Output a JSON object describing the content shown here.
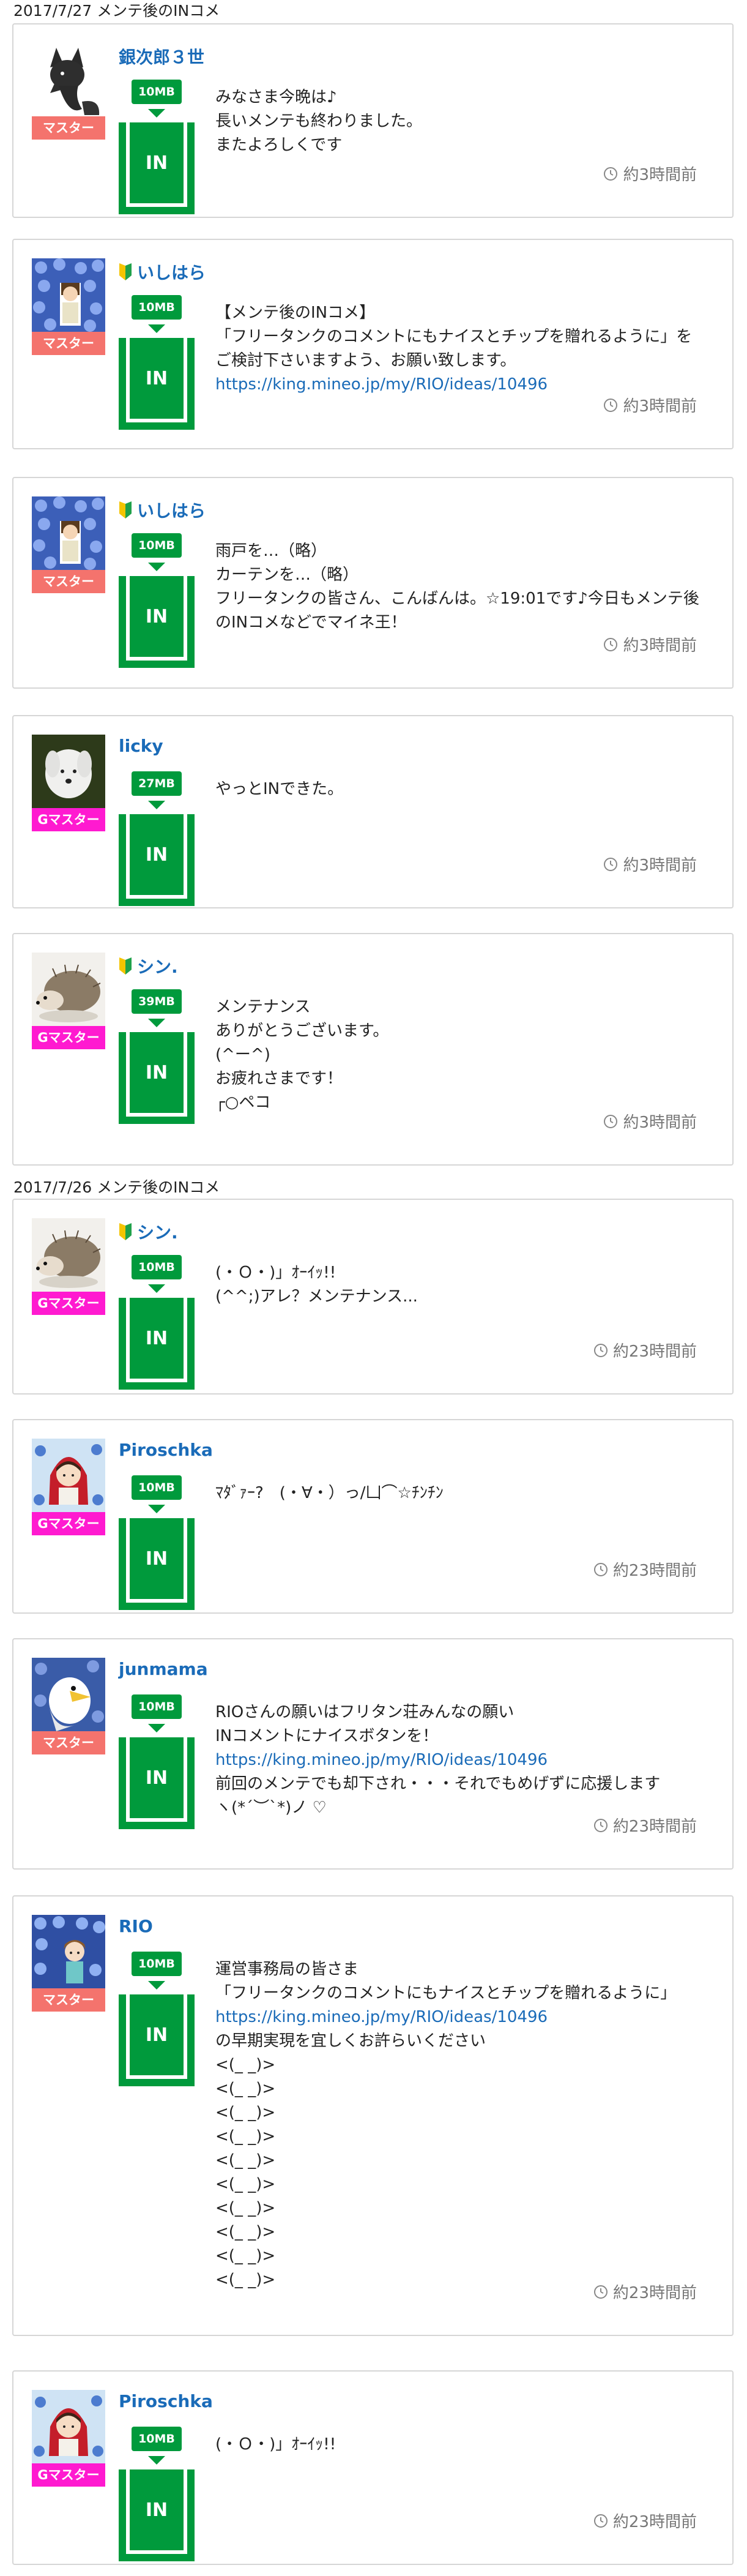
{
  "groups": [
    {
      "date_label": "2017/7/27 メンテ後のINコメ",
      "comments": [
        {
          "user": "銀次郎３世",
          "beginner": false,
          "rank": "マスター",
          "rank_type": "master",
          "avatar": "fox-avatar",
          "mb": "10MB",
          "in_label": "IN",
          "lines": [
            {
              "text": "みなさま今晩は♪"
            },
            {
              "text": "長いメンテも終わりました。"
            },
            {
              "text": "またよろしくです"
            }
          ],
          "time": "約3時間前"
        },
        {
          "user": "いしはら",
          "beginner": true,
          "rank": "マスター",
          "rank_type": "master",
          "avatar": "hydrangea-avatar",
          "mb": "10MB",
          "in_label": "IN",
          "lines": [
            {
              "text": "【メンテ後のINコメ】"
            },
            {
              "text": "「フリータンクのコメントにもナイスとチップを贈れるように」をご検討下さいますよう、お願い致します。"
            },
            {
              "text": "https://king.mineo.jp/my/RIO/ideas/10496",
              "link": true
            }
          ],
          "time": "約3時間前"
        },
        {
          "user": "いしはら",
          "beginner": true,
          "rank": "マスター",
          "rank_type": "master",
          "avatar": "hydrangea-avatar",
          "mb": "10MB",
          "in_label": "IN",
          "lines": [
            {
              "text": "雨戸を…（略）"
            },
            {
              "text": "カーテンを…（略）"
            },
            {
              "text": "フリータンクの皆さん、こんばんは。☆19:01です♪今日もメンテ後のINコメなどでマイネ王！"
            }
          ],
          "time": "約3時間前"
        },
        {
          "user": "licky",
          "beginner": false,
          "rank": "Gマスター",
          "rank_type": "g",
          "avatar": "dog-avatar",
          "mb": "27MB",
          "in_label": "IN",
          "lines": [
            {
              "text": "やっとINできた。"
            }
          ],
          "time": "約3時間前"
        },
        {
          "user": "シン.",
          "beginner": true,
          "rank": "Gマスター",
          "rank_type": "g",
          "avatar": "hedgehog-avatar",
          "mb": "39MB",
          "in_label": "IN",
          "lines": [
            {
              "text": "メンテナンス"
            },
            {
              "text": "ありがとうございます。"
            },
            {
              "text": "(^ー^)"
            },
            {
              "text": "お疲れさまです！"
            },
            {
              "text": "┌○ペコ"
            }
          ],
          "time": "約3時間前"
        }
      ]
    },
    {
      "date_label": "2017/7/26 メンテ後のINコメ",
      "comments": [
        {
          "user": "シン.",
          "beginner": true,
          "rank": "Gマスター",
          "rank_type": "g",
          "avatar": "hedgehog-avatar",
          "mb": "10MB",
          "in_label": "IN",
          "lines": [
            {
              "text": "(・Ｏ・)」ｵｰｲｯ!!"
            },
            {
              "text": "(^^;)アレ？メンテナンス..."
            }
          ],
          "time": "約23時間前"
        },
        {
          "user": "Piroschka",
          "beginner": false,
          "rank": "Gマスター",
          "rank_type": "g",
          "avatar": "girl-avatar",
          "mb": "10MB",
          "in_label": "IN",
          "lines": [
            {
              "text": "ﾏﾀﾞｧｰ?　(・∀・）っ/凵⌒☆ﾁﾝﾁﾝ"
            }
          ],
          "time": "約23時間前"
        },
        {
          "user": "junmama",
          "beginner": false,
          "rank": "マスター",
          "rank_type": "master",
          "avatar": "eagle-avatar",
          "mb": "10MB",
          "in_label": "IN",
          "lines": [
            {
              "text": "RIOさんの願いはフリタン荘みんなの願い"
            },
            {
              "text": "INコメントにナイスボタンを！"
            },
            {
              "text": "https://king.mineo.jp/my/RIO/ideas/10496",
              "link": true
            },
            {
              "text": "前回のメンテでも却下され・・・それでもめげずに応援します"
            },
            {
              "text": "ヽ(*´︶`*)ノ ♡"
            }
          ],
          "time": "約23時間前"
        },
        {
          "user": "RIO",
          "beginner": false,
          "rank": "マスター",
          "rank_type": "master",
          "avatar": "hydrangea-girl-avatar",
          "mb": "10MB",
          "in_label": "IN",
          "lines": [
            {
              "text": "運営事務局の皆さま"
            },
            {
              "text": "「フリータンクのコメントにもナイスとチップを贈れるように」"
            },
            {
              "text": "https://king.mineo.jp/my/RIO/ideas/10496",
              "link": true
            },
            {
              "text": "の早期実現を宜しくお許らいください"
            },
            {
              "text": "<(_ _)>"
            },
            {
              "text": "<(_ _)>"
            },
            {
              "text": "<(_ _)>"
            },
            {
              "text": "<(_ _)>"
            },
            {
              "text": "<(_ _)>"
            },
            {
              "text": "<(_ _)>"
            },
            {
              "text": "<(_ _)>"
            },
            {
              "text": "<(_ _)>"
            },
            {
              "text": "<(_ _)>"
            },
            {
              "text": "<(_ _)>"
            }
          ],
          "time": "約23時間前"
        },
        {
          "user": "Piroschka",
          "beginner": false,
          "rank": "Gマスター",
          "rank_type": "g",
          "avatar": "girl-avatar",
          "mb": "10MB",
          "in_label": "IN",
          "lines": [
            {
              "text": "(・Ｏ・)」ｵｰｲｯ!!"
            }
          ],
          "time": "約23時間前"
        }
      ]
    }
  ]
}
